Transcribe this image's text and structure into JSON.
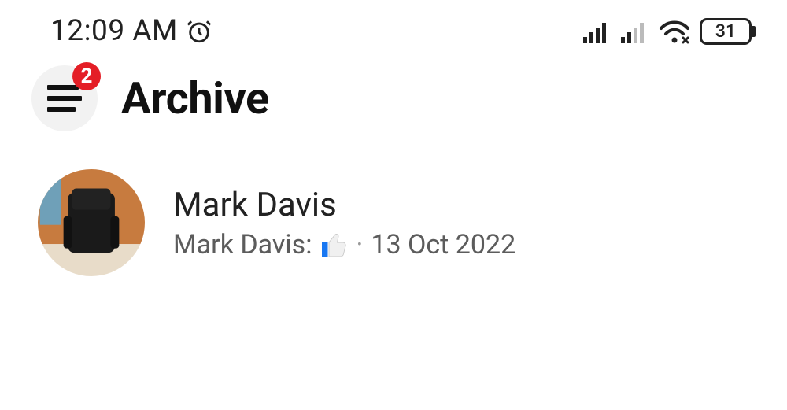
{
  "statusbar": {
    "time": "12:09 AM",
    "battery_level": "31"
  },
  "header": {
    "title": "Archive",
    "badge_count": "2"
  },
  "item": {
    "name": "Mark Davis",
    "sub_prefix": "Mark Davis:",
    "sub_separator": "·",
    "date": "13 Oct 2022"
  }
}
